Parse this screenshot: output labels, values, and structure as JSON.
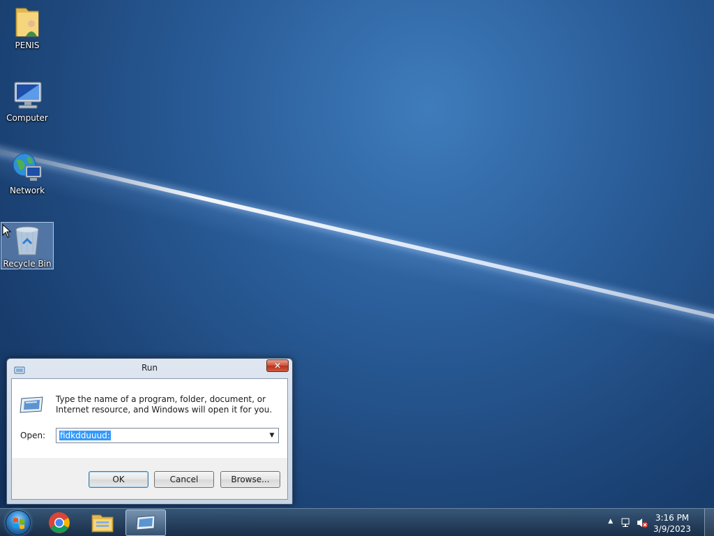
{
  "desktop": {
    "icons": [
      {
        "label": "PENIS"
      },
      {
        "label": "Computer"
      },
      {
        "label": "Network"
      },
      {
        "label": "Recycle Bin"
      }
    ]
  },
  "run_dialog": {
    "title": "Run",
    "close_glyph": "✕",
    "description": "Type the name of a program, folder, document, or Internet resource, and Windows will open it for you.",
    "open_label": "Open:",
    "open_value": "fidkdduuud:",
    "dropdown_glyph": "▼",
    "buttons": {
      "ok": "OK",
      "cancel": "Cancel",
      "browse": "Browse..."
    }
  },
  "taskbar": {
    "pinned": [
      "start-orb",
      "chrome-icon",
      "explorer-icon",
      "run-icon"
    ],
    "tray": {
      "show_hidden_glyph": "▲",
      "time": "3:16 PM",
      "date": "3/9/2023"
    }
  },
  "colors": {
    "selection": "#3399ff",
    "close_button": "#c9503a"
  }
}
